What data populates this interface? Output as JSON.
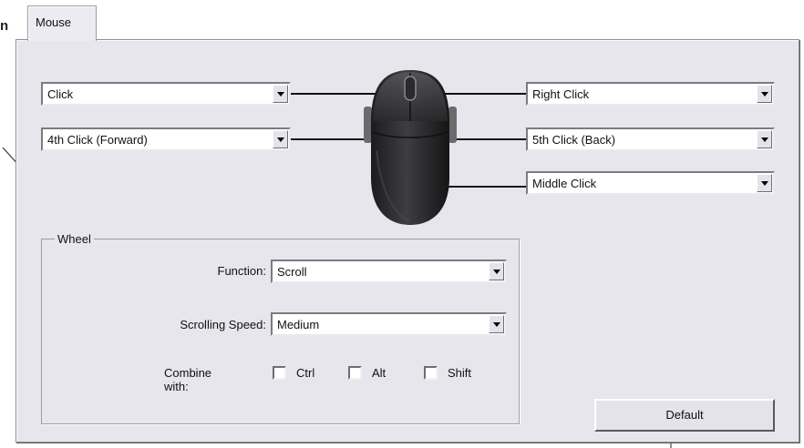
{
  "window": {
    "tab_label": "Mouse",
    "cut_off_text": "n"
  },
  "buttons": {
    "left_top": {
      "value": "Click"
    },
    "left_bottom": {
      "value": "4th Click (Forward)"
    },
    "right_top": {
      "value": "Right Click"
    },
    "right_mid": {
      "value": "5th Click (Back)"
    },
    "right_bottom": {
      "value": "Middle Click"
    }
  },
  "wheel": {
    "title": "Wheel",
    "function_label": "Function:",
    "function_value": "Scroll",
    "speed_label": "Scrolling Speed:",
    "speed_value": "Medium",
    "combine_label": "Combine with:",
    "modifiers": [
      {
        "label": "Ctrl",
        "checked": false
      },
      {
        "label": "Alt",
        "checked": false
      },
      {
        "label": "Shift",
        "checked": false
      }
    ]
  },
  "default_button": "Default",
  "icons": {
    "combo_arrow": "chevron-down-icon",
    "mouse": "mouse-illustration"
  }
}
